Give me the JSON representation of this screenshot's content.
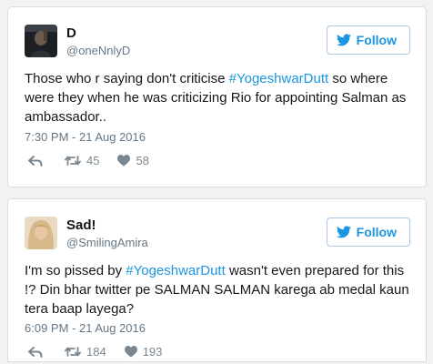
{
  "theme": {
    "link_color": "#1b95e0",
    "text_color": "#14171a",
    "meta_color": "#657786"
  },
  "tweets": [
    {
      "display_name": "D",
      "handle": "@oneNnlyD",
      "follow_label": "Follow",
      "text_before": "Those who r saying don't criticise ",
      "hashtag": "#YogeshwarDutt",
      "text_after": " so where were they when he was criticizing Rio for appointing Salman as ambassador..",
      "timestamp": "7:30 PM - 21 Aug 2016",
      "retweets": "45",
      "likes": "58",
      "avatar_icon": "profile-photo"
    },
    {
      "display_name": "Sad!",
      "handle": "@SmilingAmira",
      "follow_label": "Follow",
      "text_before": "I'm so pissed by ",
      "hashtag": "#YogeshwarDutt",
      "text_after": " wasn't even prepared for this !? Din bhar twitter pe SALMAN SALMAN karega ab medal kaun tera baap layega?",
      "timestamp": "6:09 PM - 21 Aug 2016",
      "retweets": "184",
      "likes": "193",
      "avatar_icon": "profile-photo"
    }
  ]
}
